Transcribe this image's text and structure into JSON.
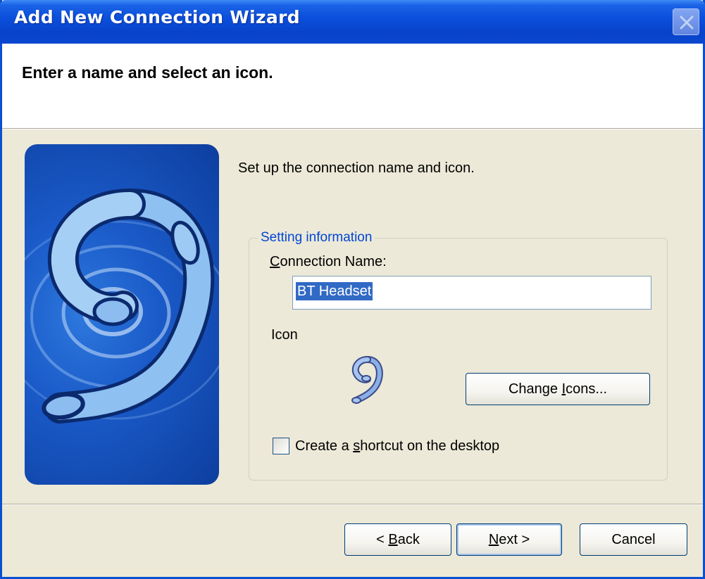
{
  "window": {
    "title": "Add New Connection Wizard"
  },
  "header": {
    "title": "Enter a name and select an icon."
  },
  "main": {
    "subtitle": "Set up the connection name and icon.",
    "group": {
      "legend": "Setting information",
      "connection_name_label_mnemonic": "C",
      "connection_name_label_rest": "onnection Name:",
      "connection_name_value": "BT Headset",
      "icon_label": "Icon",
      "change_icons_pre": "Change ",
      "change_icons_mnemonic": "I",
      "change_icons_post": "cons...",
      "shortcut_pre": "Create a ",
      "shortcut_mnemonic": "s",
      "shortcut_post": "hortcut on the desktop",
      "shortcut_checked": false
    }
  },
  "footer": {
    "back_pre": "< ",
    "back_mnemonic": "B",
    "back_post": "ack",
    "next_mnemonic": "N",
    "next_post": "ext >",
    "cancel_label": "Cancel"
  },
  "icons": {
    "close": "close-icon",
    "headset_art": "headset-illustration",
    "headset_small": "headset-icon"
  },
  "colors": {
    "titlebar": "#0b4fdc",
    "dialog_bg": "#ece9d8",
    "group_legend": "#0046d5",
    "selection": "#316ac5"
  }
}
